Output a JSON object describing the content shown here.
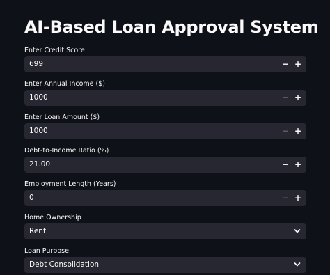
{
  "header": {
    "title": "AI-Based Loan Approval System"
  },
  "fields": {
    "credit_score": {
      "label": "Enter Credit Score",
      "value": "699",
      "minus": "−",
      "plus": "+"
    },
    "annual_income": {
      "label": "Enter Annual Income ($)",
      "value": "1000",
      "minus": "−",
      "plus": "+"
    },
    "loan_amount": {
      "label": "Enter Loan Amount ($)",
      "value": "1000",
      "minus": "−",
      "plus": "+"
    },
    "dti_ratio": {
      "label": "Debt-to-Income Ratio (%)",
      "value": "21.00",
      "minus": "−",
      "plus": "+"
    },
    "employment_length": {
      "label": "Employment Length (Years)",
      "value": "0",
      "minus": "−",
      "plus": "+"
    },
    "home_ownership": {
      "label": "Home Ownership",
      "selected": "Rent"
    },
    "loan_purpose": {
      "label": "Loan Purpose",
      "selected": "Debt Consolidation"
    }
  },
  "icons": {
    "title_icon": "rocket-icon",
    "dropdown_icon": "chevron-down-icon"
  },
  "colors": {
    "background": "#0e1117",
    "input_background": "#262730",
    "text": "#fafafa",
    "disabled": "#5f6068"
  }
}
